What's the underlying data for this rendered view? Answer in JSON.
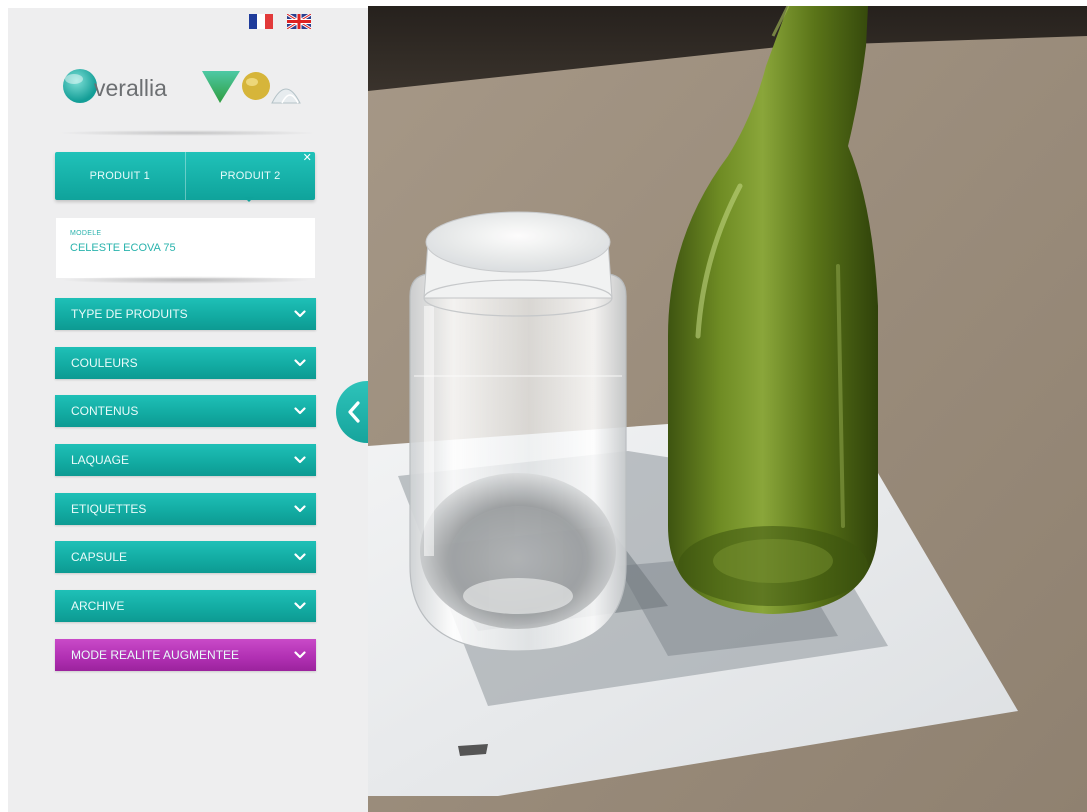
{
  "languages": [
    {
      "code": "fr",
      "icon": "flag-france-icon"
    },
    {
      "code": "en",
      "icon": "flag-uk-icon"
    }
  ],
  "brand": {
    "name": "verallia"
  },
  "products": {
    "tabs": [
      {
        "label": "PRODUIT 1"
      },
      {
        "label": "PRODUIT 2"
      }
    ],
    "close_symbol": "✕"
  },
  "model": {
    "caption": "MODELE",
    "value": "CELESTE ECOVA 75"
  },
  "menu": [
    {
      "label": "TYPE DE PRODUITS",
      "icon": "chevron-down-icon"
    },
    {
      "label": "COULEURS",
      "icon": "chevron-down-icon"
    },
    {
      "label": "CONTENUS",
      "icon": "chevron-down-icon"
    },
    {
      "label": "LAQUAGE",
      "icon": "chevron-down-icon"
    },
    {
      "label": "ETIQUETTES",
      "icon": "chevron-down-icon"
    },
    {
      "label": "CAPSULE",
      "icon": "chevron-down-icon"
    },
    {
      "label": "ARCHIVE",
      "icon": "chevron-down-icon"
    },
    {
      "label": "MODE REALITE AUGMENTEE",
      "icon": "chevron-down-icon"
    }
  ],
  "panel_toggle": {
    "icon": "chevron-left-icon"
  },
  "colors": {
    "teal": "#12aaa1",
    "magenta": "#b02fb2",
    "panel_bg": "#eeeeef",
    "bottle_green": "#5f7a1c"
  }
}
